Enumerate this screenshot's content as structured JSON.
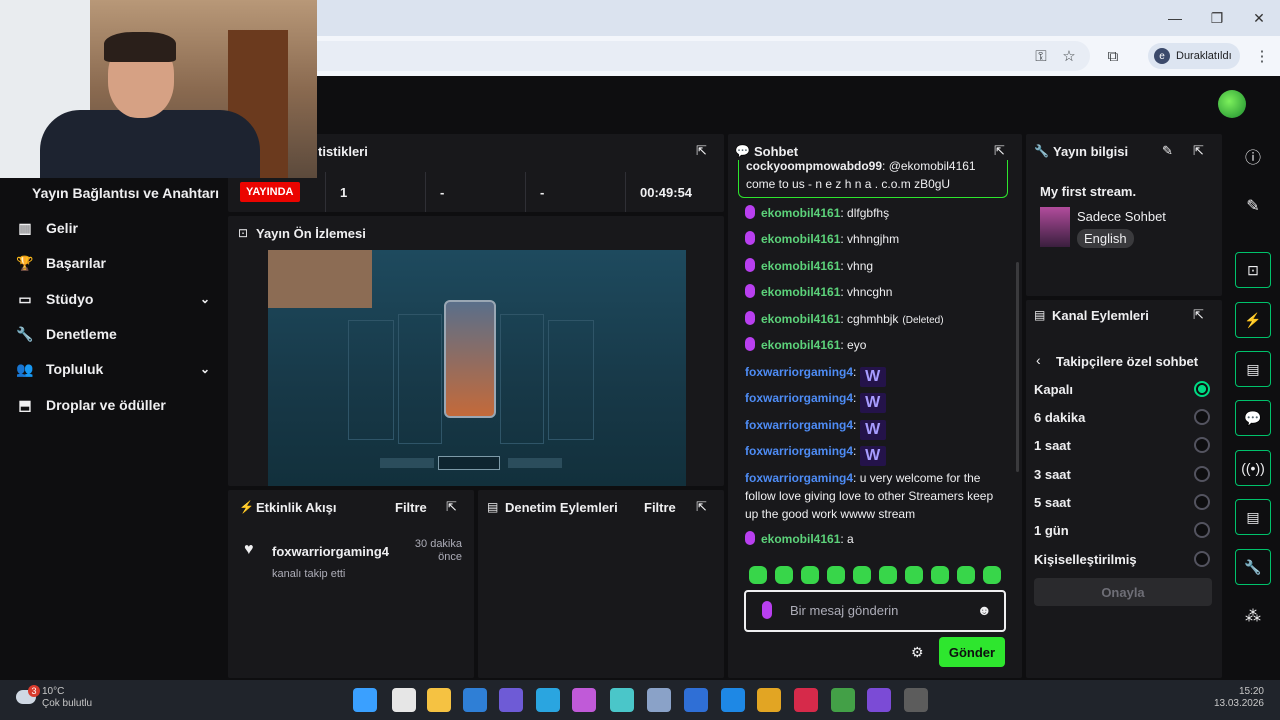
{
  "browser": {
    "profile_initial": "e",
    "profile_label": "Duraklatıldı",
    "win_min": "—",
    "win_max": "❐",
    "win_close": "✕"
  },
  "sidebar": {
    "header": "Yayın Bağlantısı ve Anahtarı",
    "items": [
      {
        "label": "Gelir",
        "icon": "chart-icon",
        "glyph": "▥"
      },
      {
        "label": "Başarılar",
        "icon": "trophy-icon",
        "glyph": "🏆"
      },
      {
        "label": "Stüdyo",
        "icon": "studio-icon",
        "glyph": "▭",
        "chevron": true
      },
      {
        "label": "Denetleme",
        "icon": "wrench-icon",
        "glyph": "🔧"
      },
      {
        "label": "Topluluk",
        "icon": "people-icon",
        "glyph": "👥",
        "chevron": true
      },
      {
        "label": "Droplar ve ödüller",
        "icon": "gift-icon",
        "glyph": "⬒"
      }
    ]
  },
  "stats": {
    "title_partial": "tistikleri",
    "live": "YAYINDA",
    "viewers": "1",
    "col3": "-",
    "col4": "-",
    "time": "00:49:54"
  },
  "preview": {
    "title": "Yayın Ön İzlemesi"
  },
  "activity": {
    "title": "Etkinlik Akışı",
    "filter": "Filtre",
    "event_user": "foxwarriorgaming4",
    "event_time": "30 dakika önce",
    "event_desc": "kanalı takip etti"
  },
  "mod": {
    "title": "Denetim Eylemleri",
    "filter": "Filtre"
  },
  "chat": {
    "title": "Sohbet",
    "top_partial_user": "cockyoompmowabdo99",
    "top_partial_msg": "@ekomobil4161",
    "highlight_msg": "come to us - n e z h n a . c.o.m zB0gU",
    "messages": [
      {
        "user": "ekomobil4161",
        "text": "dlfgbfhş",
        "color": "green",
        "mic": true
      },
      {
        "user": "ekomobil4161",
        "text": "vhhngjhm",
        "color": "green",
        "mic": true
      },
      {
        "user": "ekomobil4161",
        "text": "vhng",
        "color": "green",
        "mic": true
      },
      {
        "user": "ekomobil4161",
        "text": "vhncghn",
        "color": "green",
        "mic": true
      },
      {
        "user": "ekomobil4161",
        "text": "cghmhbjk",
        "deleted": "(Deleted)",
        "color": "green",
        "mic": true
      },
      {
        "user": "ekomobil4161",
        "text": "eyo",
        "color": "green",
        "mic": true
      },
      {
        "user": "foxwarriorgaming4",
        "emote": "W",
        "color": "blue"
      },
      {
        "user": "foxwarriorgaming4",
        "emote": "W",
        "color": "blue"
      },
      {
        "user": "foxwarriorgaming4",
        "emote": "W",
        "color": "blue"
      },
      {
        "user": "foxwarriorgaming4",
        "emote": "W",
        "color": "blue"
      }
    ],
    "long_user": "foxwarriorgaming4",
    "long_msg": "u very welcome for the follow love giving love to other Streamers keep up the good work wwww stream",
    "last_user": "ekomobil4161",
    "last_msg": "a",
    "input_placeholder": "Bir mesaj gönderin",
    "send": "Gönder"
  },
  "info": {
    "title": "Yayın bilgisi",
    "stream_title": "My first stream.",
    "category": "Sadece Sohbet",
    "language": "English"
  },
  "actions": {
    "title": "Kanal Eylemleri",
    "sub_title": "Takipçilere özel sohbet",
    "options": [
      "Kapalı",
      "6 dakika",
      "1 saat",
      "3 saat",
      "5 saat",
      "1 gün",
      "Kişiselleştirilmiş"
    ],
    "selected": 0,
    "confirm": "Onayla"
  },
  "taskbar": {
    "weather_badge": "3",
    "weather_temp": "10°C",
    "weather_desc": "Çok bulutlu",
    "time": "15:20",
    "date": "13.03.2026"
  }
}
